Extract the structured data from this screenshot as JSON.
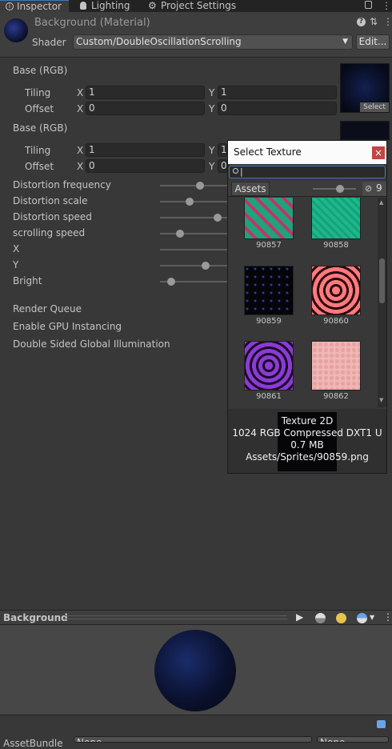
{
  "tabs": [
    {
      "label": "Inspector",
      "icon": "info-icon"
    },
    {
      "label": "Lighting",
      "icon": "lightbulb-icon"
    },
    {
      "label": "Project Settings",
      "icon": "gear-icon"
    }
  ],
  "header": {
    "title": "Background (Material)",
    "shader_label": "Shader",
    "shader_value": "Custom/DoubleOscillationScrolling",
    "edit_label": "Edit..."
  },
  "props": {
    "tex1": {
      "label": "Base (RGB)",
      "tiling_label": "Tiling",
      "offset_label": "Offset",
      "x_label": "X",
      "y_label": "Y",
      "tiling_x": "1",
      "tiling_y": "1",
      "offset_x": "0",
      "offset_y": "0",
      "select_label": "Select"
    },
    "tex2": {
      "label": "Base (RGB)",
      "tiling_label": "Tiling",
      "offset_label": "Offset",
      "x_label": "X",
      "y_label": "Y",
      "tiling_x": "1",
      "tiling_y": "1",
      "offset_x": "0",
      "offset_y": "0"
    },
    "sliders": [
      {
        "label": "Distortion frequency",
        "level": 0.45
      },
      {
        "label": "Distortion scale",
        "level": 0.34
      },
      {
        "label": "Distortion speed",
        "level": 0.65
      },
      {
        "label": "scrolling speed",
        "level": 0.23
      },
      {
        "label": "X",
        "level": 0.0
      },
      {
        "label": "Y",
        "level": 0.52
      },
      {
        "label": "Bright",
        "level": 0.13
      }
    ],
    "render_queue": "Render Queue",
    "gpu_instancing": "Enable GPU Instancing",
    "double_sided_gi": "Double Sided Global Illumination"
  },
  "popup": {
    "title": "Select Texture",
    "close": "×",
    "search_value": "|",
    "assets_tab": "Assets",
    "hidden_count": "9",
    "items": [
      {
        "name": "90857",
        "color": "#1fa37a"
      },
      {
        "name": "90858",
        "color": "#1db88a"
      },
      {
        "name": "90859",
        "color": "#050509"
      },
      {
        "name": "90860",
        "color": "#ff7a7a"
      },
      {
        "name": "90861",
        "color": "#8b3bd1"
      },
      {
        "name": "90862",
        "color": "#f0b7b7"
      }
    ],
    "info_type": "Texture 2D",
    "info_format": "1024  RGB Compressed DXT1 U",
    "info_size": "0.7 MB",
    "info_path": "Assets/Sprites/90859.png"
  },
  "preview": {
    "title": "Background"
  },
  "asset_bar": {
    "label": "AssetBundle",
    "value1": "None",
    "value2": "None"
  },
  "colors": {
    "accent": "#3a79bb",
    "close_red": "#c24545"
  }
}
